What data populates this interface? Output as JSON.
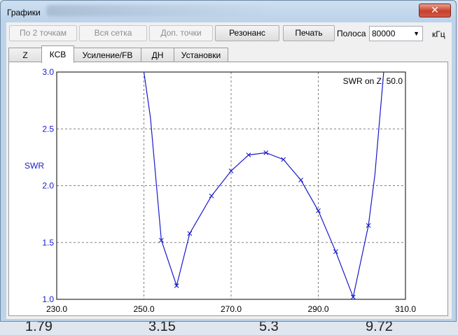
{
  "window": {
    "title": "Графики",
    "close_glyph": "✕"
  },
  "toolbar": {
    "btn_two_points": "По 2 точкам",
    "btn_whole_grid": "Вся сетка",
    "btn_extra_points": "Доп. точки",
    "btn_resonance": "Резонанс",
    "btn_print": "Печать",
    "band_label": "Полоса",
    "band_value": "80000",
    "band_unit": "кГц"
  },
  "tabs": [
    "Z",
    "КСВ",
    "Усиление/FB",
    "ДН",
    "Установки"
  ],
  "active_tab": 1,
  "background_numbers": [
    "1.79",
    "3.15",
    "5.3",
    "9.72"
  ],
  "chart_data": {
    "type": "line",
    "annotation": "SWR on Z: 50.0",
    "ylabel": "SWR",
    "xlabel": "",
    "xlim": [
      230,
      310
    ],
    "ylim": [
      1.0,
      3.0
    ],
    "xticks": [
      "230.0",
      "250.0",
      "270.0",
      "290.0",
      "310.0"
    ],
    "yticks": [
      "1.0",
      "1.5",
      "2.0",
      "2.5",
      "3.0"
    ],
    "grid": true,
    "line_color": "#1a1acb",
    "series": [
      {
        "x": [
          250.0,
          251.5,
          254.0,
          257.5,
          260.5,
          265.5,
          270.0,
          274.0,
          278.0,
          282.0,
          286.0,
          290.0,
          294.0,
          298.0,
          301.5,
          303.0,
          305.0
        ],
        "y": [
          3.0,
          2.6,
          1.52,
          1.12,
          1.58,
          1.91,
          2.13,
          2.27,
          2.29,
          2.23,
          2.05,
          1.78,
          1.42,
          1.02,
          1.65,
          2.1,
          3.0
        ],
        "markers": [
          false,
          false,
          true,
          true,
          true,
          true,
          true,
          true,
          true,
          true,
          true,
          true,
          true,
          true,
          true,
          false,
          false
        ]
      }
    ]
  }
}
